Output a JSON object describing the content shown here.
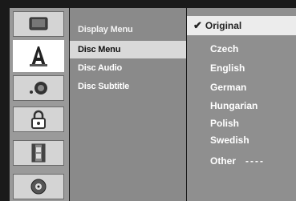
{
  "sidebar": {
    "icons": [
      "display-icon",
      "language-icon",
      "audio-icon",
      "lock-icon",
      "film-icon",
      "disc-icon"
    ],
    "active_index": 1
  },
  "submenu": {
    "items": [
      "Display Menu",
      "Disc Menu",
      "Disc Audio",
      "Disc Subtitle"
    ],
    "active_index": 1
  },
  "options": {
    "items": [
      "Original",
      "Czech",
      "English",
      "German",
      "Hungarian",
      "Polish",
      "Swedish",
      "Other"
    ],
    "selected_index": 0,
    "other_code": "----",
    "check_mark": "✔"
  },
  "colors": {
    "rail_bg": "#9a9a9a",
    "submenu_bg": "#8a8a8a",
    "options_bg": "#8f8f8f",
    "highlight": "#ececec"
  }
}
